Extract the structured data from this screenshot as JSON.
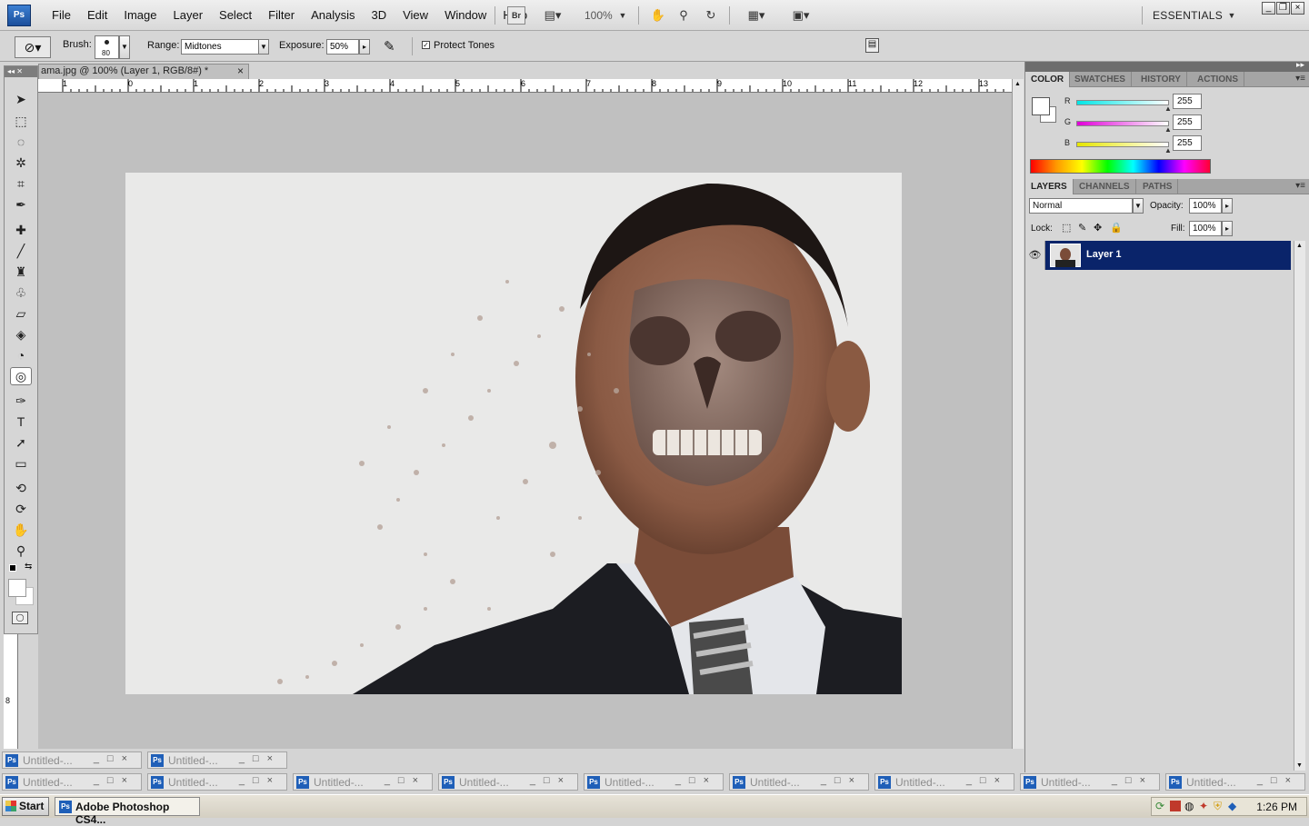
{
  "app": {
    "logo": "Ps",
    "workspace": "ESSENTIALS",
    "zoom": "100%"
  },
  "menu": [
    "File",
    "Edit",
    "Image",
    "Layer",
    "Select",
    "Filter",
    "Analysis",
    "3D",
    "View",
    "Window",
    "Help"
  ],
  "menubar_buttons": {
    "bridge": "Br"
  },
  "options": {
    "brush_label": "Brush:",
    "brush_size": "80",
    "range_label": "Range:",
    "range_value": "Midtones",
    "exposure_label": "Exposure:",
    "exposure_value": "50%",
    "protect_tones_label": "Protect Tones",
    "protect_tones_checked": true
  },
  "document": {
    "tab_title": "ama.jpg @ 100% (Layer 1, RGB/8#) *",
    "ruler_marks": [
      "1",
      "0",
      "1",
      "2",
      "3",
      "4",
      "5",
      "6",
      "7",
      "8",
      "9",
      "10",
      "11",
      "12",
      "13"
    ],
    "vruler_mark": "8"
  },
  "doc_windows": {
    "title": "Untitled-...",
    "row1_count": 2,
    "row2_count": 9
  },
  "color_panel": {
    "tabs": [
      "COLOR",
      "SWATCHES",
      "HISTORY",
      "ACTIONS"
    ],
    "channels": [
      {
        "name": "R",
        "value": "255",
        "color": "#20d8d8"
      },
      {
        "name": "G",
        "value": "255",
        "color": "#e020d0"
      },
      {
        "name": "B",
        "value": "255",
        "color": "#e0e020"
      }
    ]
  },
  "layers_panel": {
    "tabs": [
      "LAYERS",
      "CHANNELS",
      "PATHS"
    ],
    "blend_mode": "Normal",
    "opacity_label": "Opacity:",
    "opacity": "100%",
    "lock_label": "Lock:",
    "fill_label": "Fill:",
    "fill": "100%",
    "layers": [
      {
        "name": "Layer 1",
        "visible": true,
        "selected": true
      }
    ]
  },
  "taskbar": {
    "start": "Start",
    "active_app": "Adobe Photoshop CS4...",
    "clock": "1:26 PM"
  },
  "colors": {
    "selected_layer": "#0a246a",
    "workarea": "#c0c0c0",
    "ps_blue": "#1f5fb8"
  }
}
